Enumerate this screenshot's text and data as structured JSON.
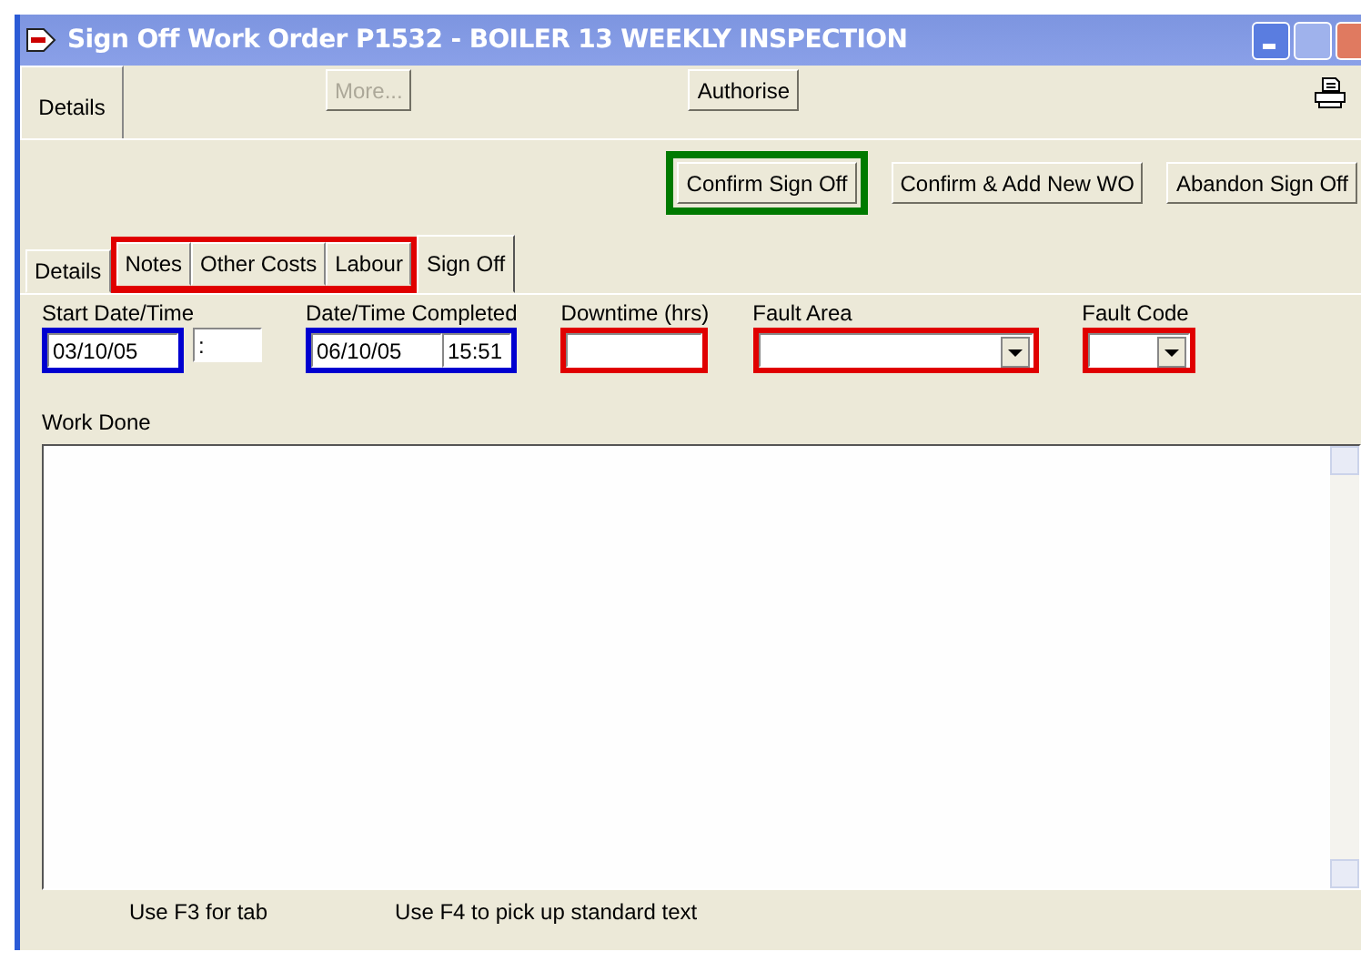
{
  "window": {
    "title": "Sign Off Work Order P1532 - BOILER 13 WEEKLY INSPECTION"
  },
  "top_tab": {
    "label": "Details",
    "selected": true
  },
  "toolbar": [
    {
      "label": "More...",
      "disabled": true
    },
    {
      "label": "Authorise",
      "disabled": false
    }
  ],
  "actions": [
    {
      "label": "Confirm Sign Off",
      "color": "#007a00"
    },
    {
      "label": "Confirm & Add New WO"
    },
    {
      "label": "Abandon Sign Off"
    }
  ],
  "tabs": [
    {
      "label": "Details",
      "selected": false,
      "highlighted": false
    },
    {
      "label": "Notes",
      "selected": false,
      "highlighted": true
    },
    {
      "label": "Other Costs",
      "selected": false,
      "highlighted": true
    },
    {
      "label": "Labour",
      "selected": false,
      "highlighted": true
    },
    {
      "label": "Sign Off",
      "selected": true,
      "highlighted": false
    }
  ],
  "fields": [
    {
      "label": "Start Date/Time",
      "kind": "datetime",
      "date": "03/10/05",
      "time": ":",
      "color": "#0000d0",
      "wrap_time": false
    },
    {
      "label": "Date/Time Completed",
      "kind": "datetime",
      "date": "06/10/05",
      "time": "15:51",
      "color": "#0000d0",
      "wrap_time": true
    },
    {
      "label": "Downtime (hrs)",
      "kind": "text",
      "color": "#e00000"
    },
    {
      "label": "Fault Area",
      "kind": "combo",
      "color": "#e00000"
    },
    {
      "label": "Fault Code",
      "kind": "combo",
      "color": "#e00000"
    }
  ],
  "work_done": {
    "label": "Work Done"
  },
  "status_bar": [
    "Use F3 for tab",
    "Use F4 to pick up standard text"
  ]
}
